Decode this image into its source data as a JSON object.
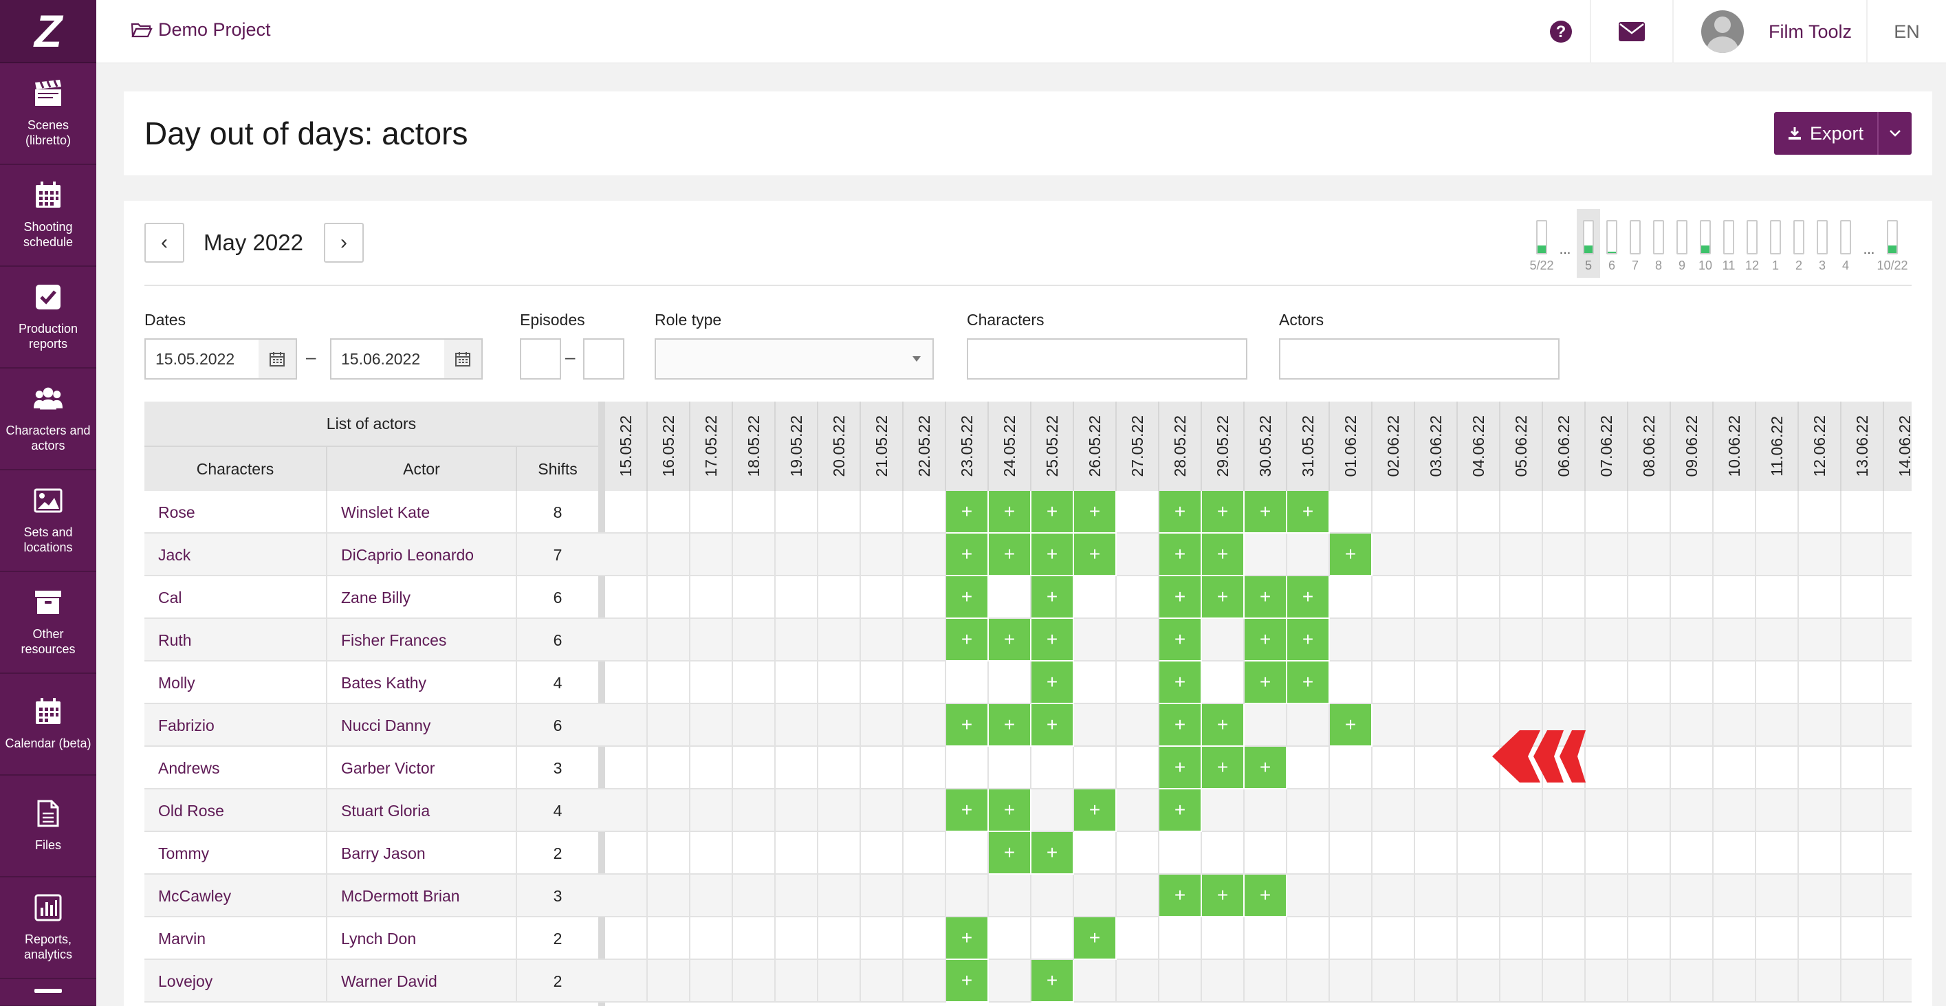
{
  "sidebar": {
    "logo": "Z",
    "items": [
      {
        "label": "Scenes (libretto)",
        "icon": "clapperboard-icon"
      },
      {
        "label": "Shooting schedule",
        "icon": "calendar-grid-icon"
      },
      {
        "label": "Production reports",
        "icon": "checkbox-icon"
      },
      {
        "label": "Characters and actors",
        "icon": "people-icon"
      },
      {
        "label": "Sets and locations",
        "icon": "image-icon"
      },
      {
        "label": "Other resources",
        "icon": "archive-box-icon"
      },
      {
        "label": "Calendar (beta)",
        "icon": "calendar-icon"
      },
      {
        "label": "Files",
        "icon": "file-icon"
      },
      {
        "label": "Reports, analytics",
        "icon": "bar-chart-icon"
      }
    ]
  },
  "header": {
    "project": "Demo Project",
    "user_name": "Film Toolz",
    "language": "EN"
  },
  "page": {
    "title": "Day out of days: actors",
    "export_label": "Export"
  },
  "calendar": {
    "month": "May 2022",
    "prev": "‹",
    "next": "›",
    "mini_bars": [
      {
        "label": "5/22",
        "fill": 0.25
      },
      {
        "label": "...",
        "dots": true
      },
      {
        "label": "5",
        "fill": 0.25,
        "selected": true
      },
      {
        "label": "6",
        "fill": 0.04
      },
      {
        "label": "7",
        "fill": 0
      },
      {
        "label": "8",
        "fill": 0
      },
      {
        "label": "9",
        "fill": 0
      },
      {
        "label": "10",
        "fill": 0.25
      },
      {
        "label": "11",
        "fill": 0
      },
      {
        "label": "12",
        "fill": 0
      },
      {
        "label": "1",
        "fill": 0
      },
      {
        "label": "2",
        "fill": 0
      },
      {
        "label": "3",
        "fill": 0
      },
      {
        "label": "4",
        "fill": 0
      },
      {
        "label": "...",
        "dots": true
      },
      {
        "label": "10/22",
        "fill": 0.25
      }
    ]
  },
  "filters": {
    "dates_label": "Dates",
    "date_from": "15.05.2022",
    "date_to": "15.06.2022",
    "episodes_label": "Episodes",
    "role_type_label": "Role type",
    "characters_label": "Characters",
    "actors_label": "Actors"
  },
  "table": {
    "list_header": "List of actors",
    "col_characters": "Characters",
    "col_actor": "Actor",
    "col_shifts": "Shifts",
    "dates": [
      "15.05.22",
      "16.05.22",
      "17.05.22",
      "18.05.22",
      "19.05.22",
      "20.05.22",
      "21.05.22",
      "22.05.22",
      "23.05.22",
      "24.05.22",
      "25.05.22",
      "26.05.22",
      "27.05.22",
      "28.05.22",
      "29.05.22",
      "30.05.22",
      "31.05.22",
      "01.06.22",
      "02.06.22",
      "03.06.22",
      "04.06.22",
      "05.06.22",
      "06.06.22",
      "07.06.22",
      "08.06.22",
      "09.06.22",
      "10.06.22",
      "11.06.22",
      "12.06.22",
      "13.06.22",
      "14.06.22"
    ],
    "cell_mark": "+",
    "rows": [
      {
        "character": "Rose",
        "actor": "Winslet Kate",
        "shifts": "8",
        "days": [
          8,
          9,
          10,
          11,
          13,
          14,
          15,
          16
        ]
      },
      {
        "character": "Jaсk",
        "actor": "DiCaprio Leonardo",
        "shifts": "7",
        "days": [
          8,
          9,
          10,
          11,
          13,
          14,
          17
        ]
      },
      {
        "character": "Cal",
        "actor": "Zane Billy",
        "shifts": "6",
        "days": [
          8,
          10,
          13,
          14,
          15,
          16
        ]
      },
      {
        "character": "Ruth",
        "actor": "Fisher Frances",
        "shifts": "6",
        "days": [
          8,
          9,
          10,
          13,
          15,
          16
        ]
      },
      {
        "character": "Molly",
        "actor": "Bates Kathy",
        "shifts": "4",
        "days": [
          10,
          13,
          15,
          16
        ]
      },
      {
        "character": "Fabrizio",
        "actor": "Nucci Danny",
        "shifts": "6",
        "days": [
          8,
          9,
          10,
          13,
          14,
          17
        ]
      },
      {
        "character": "Andrews",
        "actor": "Garber Victor",
        "shifts": "3",
        "days": [
          13,
          14,
          15
        ]
      },
      {
        "character": "Old Rose",
        "actor": "Stuart Gloria",
        "shifts": "4",
        "days": [
          8,
          9,
          11,
          13
        ]
      },
      {
        "character": "Tommy",
        "actor": "Barry Jason",
        "shifts": "2",
        "days": [
          9,
          10
        ]
      },
      {
        "character": "McCawley",
        "actor": "McDermott Brian",
        "shifts": "3",
        "days": [
          13,
          14,
          15
        ]
      },
      {
        "character": "Marvin",
        "actor": "Lynch Don",
        "shifts": "2",
        "days": [
          8,
          11
        ]
      },
      {
        "character": "Lovejoy",
        "actor": "Warner David",
        "shifts": "2",
        "days": [
          8,
          10
        ]
      }
    ]
  },
  "colors": {
    "brand": "#5e1a55",
    "accent_green": "#6cc94f",
    "arrow_red": "#e8262b"
  }
}
